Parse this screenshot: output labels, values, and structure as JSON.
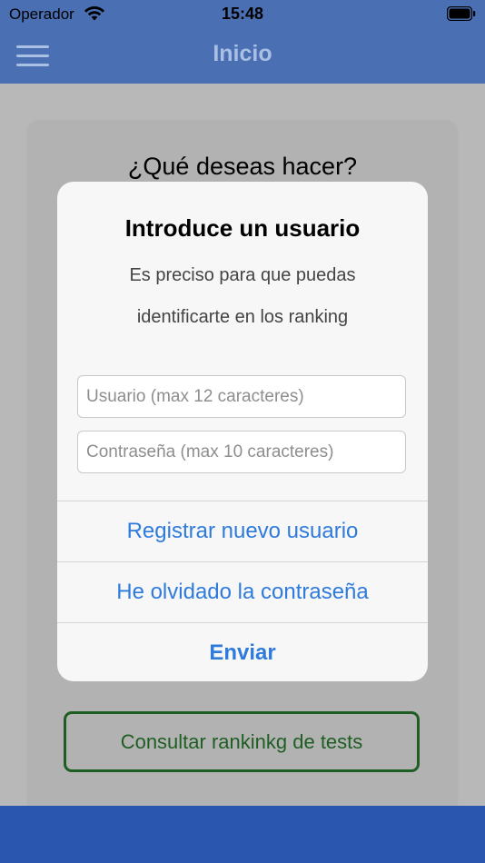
{
  "status_bar": {
    "carrier": "Operador",
    "time": "15:48",
    "wifi_icon": "wifi-icon",
    "battery_icon": "battery-icon"
  },
  "nav": {
    "title": "Inicio",
    "menu_icon": "hamburger-menu-icon"
  },
  "main": {
    "question": "¿Qué deseas hacer?",
    "ranking_button": "Consultar rankinkg de tests"
  },
  "alert": {
    "title": "Introduce un usuario",
    "message_line1": "Es preciso para que puedas",
    "message_line2": "identificarte en los ranking",
    "username": {
      "value": "",
      "placeholder": "Usuario (max 12 caracteres)"
    },
    "password": {
      "value": "",
      "placeholder": "Contraseña (max 10 caracteres)"
    },
    "actions": {
      "register": "Registrar nuevo usuario",
      "forgot": "He olvidado la contraseña",
      "send": "Enviar"
    }
  },
  "colors": {
    "nav_bar": "#4a6fb2",
    "bottom_bar": "#2a56b0",
    "alert_action": "#2f7bdc",
    "ranking_button_border": "#1f5e23"
  }
}
